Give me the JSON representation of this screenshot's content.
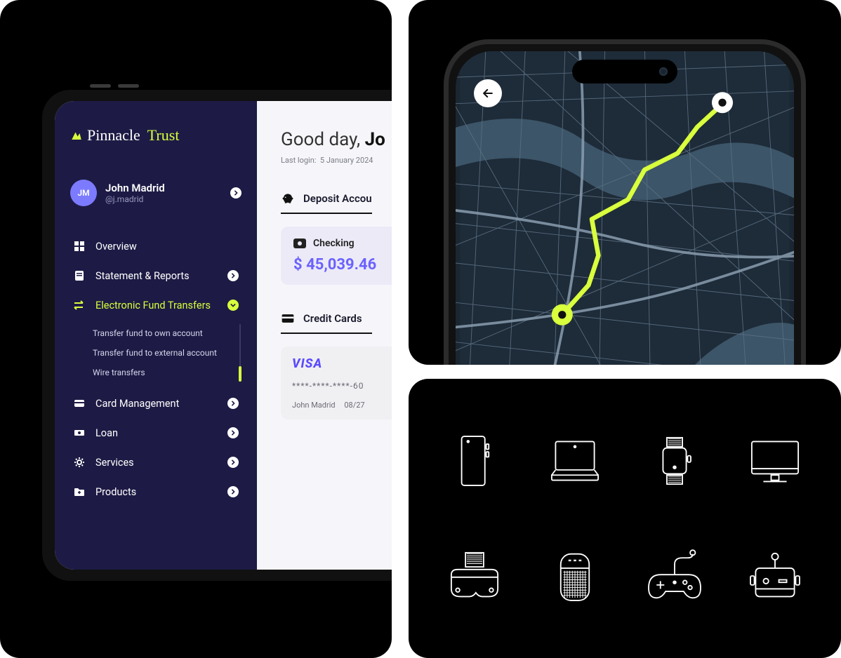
{
  "brand": {
    "part1": "Pinnacle",
    "part2": "Trust"
  },
  "profile": {
    "initials": "JM",
    "name": "John Madrid",
    "handle": "@j.madrid"
  },
  "nav": {
    "overview": "Overview",
    "statement": "Statement & Reports",
    "eft": "Electronic Fund Transfers",
    "eft_sub": {
      "own": "Transfer fund to own account",
      "external": "Transfer fund to external account",
      "wire": "Wire transfers"
    },
    "card": "Card Management",
    "loan": "Loan",
    "services": "Services",
    "products": "Products"
  },
  "main": {
    "greeting_prefix": "Good day, ",
    "greeting_name": "Jo",
    "last_login_label": "Last login:",
    "last_login_value": "5 January 2024",
    "deposit_heading": "Deposit Accou",
    "checking_label": "Checking",
    "checking_balance": "$ 45,039.46",
    "credit_heading": "Credit Cards",
    "cc_brand": "VISA",
    "cc_number": "****-****-****-60",
    "cc_holder": "John Madrid",
    "cc_exp": "08/27"
  },
  "devices": [
    "phone",
    "laptop",
    "watch",
    "monitor",
    "vr-headset",
    "smart-speaker",
    "gamepad",
    "robot"
  ]
}
